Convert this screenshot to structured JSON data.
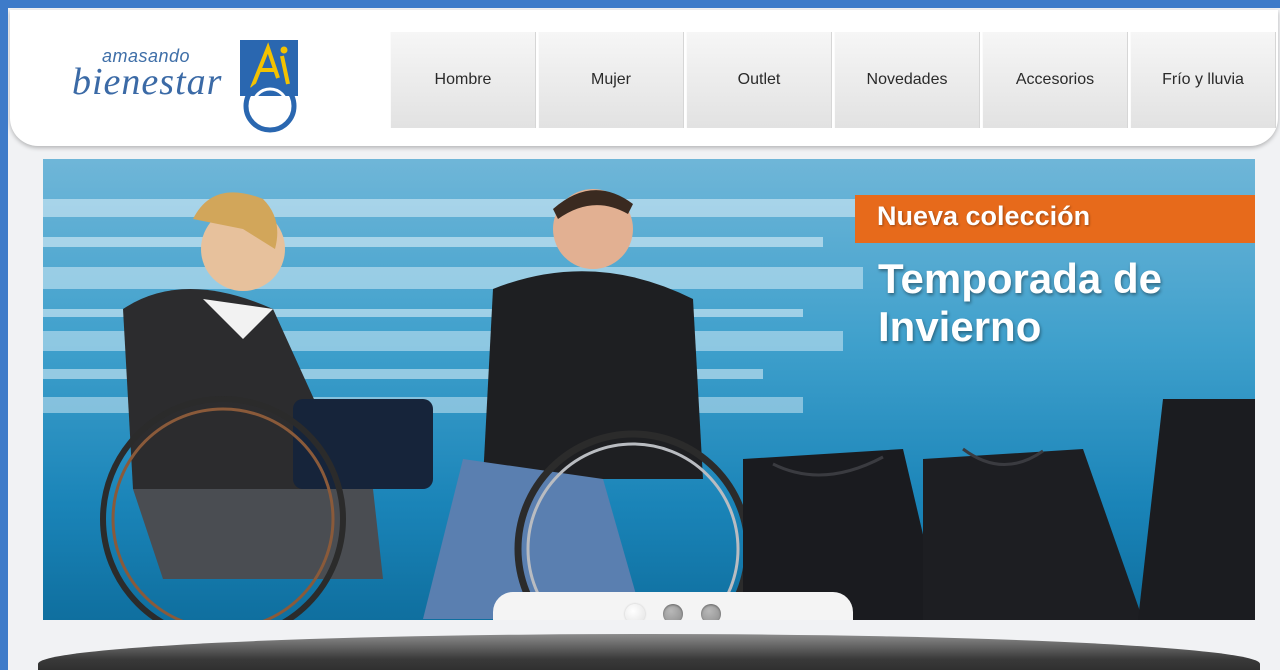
{
  "brand": {
    "top_word": "amasando",
    "main_word": "bienestar",
    "accent_color": "#3b6aa6",
    "mark_color": "#f3c200"
  },
  "nav": {
    "items": [
      {
        "label": "Hombre"
      },
      {
        "label": "Mujer"
      },
      {
        "label": "Outlet"
      },
      {
        "label": "Novedades"
      },
      {
        "label": "Accesorios"
      },
      {
        "label": "Frío y lluvia"
      }
    ]
  },
  "hero": {
    "tag": "Nueva colección",
    "headline_line1": "Temporada de",
    "headline_line2": "Invierno",
    "tag_color": "#e76a1b",
    "slides_total": 3,
    "active_slide": 1
  }
}
